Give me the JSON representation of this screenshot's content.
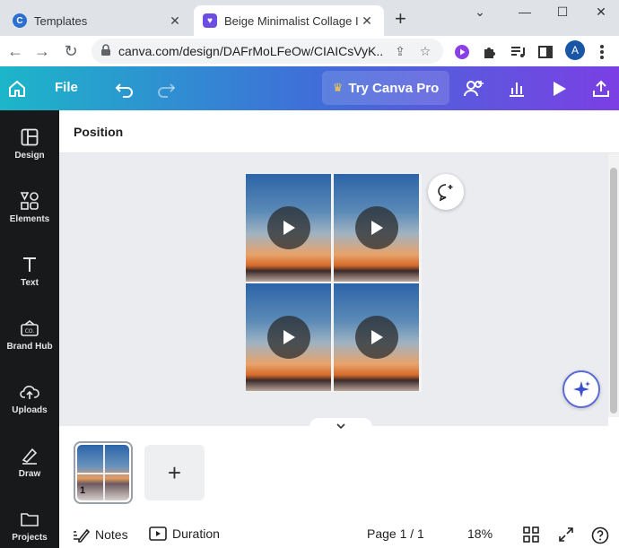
{
  "browser": {
    "tabs": [
      {
        "title": "Templates",
        "favicon_color": "#2b6fd1"
      },
      {
        "title": "Beige Minimalist Collage Ins",
        "favicon_color": "#6e4ee0"
      }
    ],
    "new_tab_label": "+",
    "url": "canva.com/design/DAFrMoLFeOw/CIAICsVyK..."
  },
  "toolbar": {
    "file_label": "File",
    "try_pro_label": "Try Canva Pro"
  },
  "sidebar": {
    "items": [
      {
        "label": "Design"
      },
      {
        "label": "Elements"
      },
      {
        "label": "Text"
      },
      {
        "label": "Brand Hub"
      },
      {
        "label": "Uploads"
      },
      {
        "label": "Draw"
      },
      {
        "label": "Projects"
      }
    ]
  },
  "panel": {
    "title": "Position"
  },
  "pages": {
    "thumb_number": "1",
    "add_label": "+"
  },
  "footer": {
    "notes_label": "Notes",
    "duration_label": "Duration",
    "page_indicator": "Page 1 / 1",
    "zoom": "18%",
    "help_label": "?"
  },
  "colors": {
    "toolbar_gradient_start": "#1cb6c9",
    "toolbar_gradient_end": "#7b3fe4",
    "sidebar_bg": "#18191b",
    "canvas_bg": "#ebecf0"
  }
}
